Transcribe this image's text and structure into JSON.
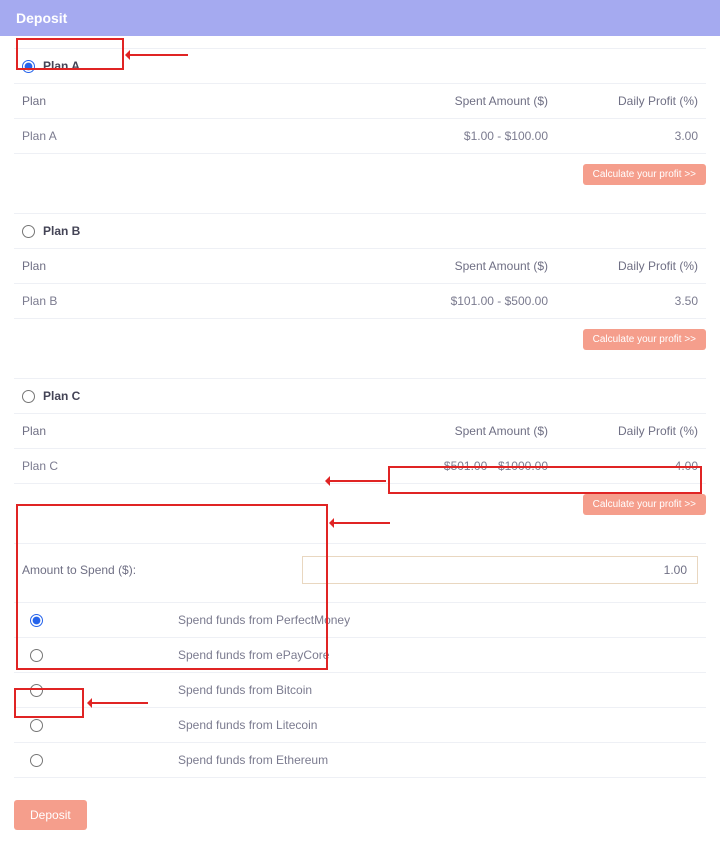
{
  "header": {
    "title": "Deposit"
  },
  "cols": {
    "plan": "Plan",
    "spent": "Spent Amount ($)",
    "profit": "Daily Profit (%)"
  },
  "calc_label": "Calculate your profit >>",
  "plans": [
    {
      "name": "Plan A",
      "range": "$1.00 - $100.00",
      "profit": "3.00",
      "selected": true
    },
    {
      "name": "Plan B",
      "range": "$101.00 - $500.00",
      "profit": "3.50",
      "selected": false
    },
    {
      "name": "Plan C",
      "range": "$501.00 - $1000.00",
      "profit": "4.00",
      "selected": false
    }
  ],
  "amount": {
    "label": "Amount to Spend ($):",
    "value": "1.00"
  },
  "funds": [
    {
      "label": "Spend funds from PerfectMoney",
      "selected": true
    },
    {
      "label": "Spend funds from ePayCore",
      "selected": false
    },
    {
      "label": "Spend funds from Bitcoin",
      "selected": false
    },
    {
      "label": "Spend funds from Litecoin",
      "selected": false
    },
    {
      "label": "Spend funds from Ethereum",
      "selected": false
    }
  ],
  "deposit_label": "Deposit"
}
